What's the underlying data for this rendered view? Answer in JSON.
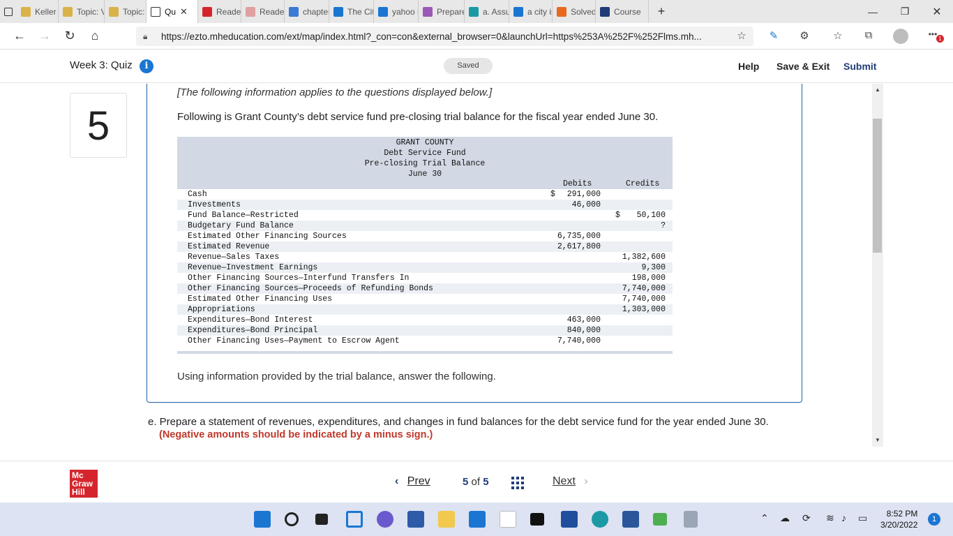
{
  "browser": {
    "tabs": [
      {
        "label": "Keller G",
        "icon": "shield-icon",
        "color": "#d9b24a"
      },
      {
        "label": "Topic: V",
        "icon": "shield-icon",
        "color": "#d9b24a"
      },
      {
        "label": "Topic: W",
        "icon": "shield-icon",
        "color": "#d9b24a"
      },
      {
        "label": "Qu",
        "icon": "page-icon",
        "color": "#ffffff",
        "active": true
      },
      {
        "label": "ReaderL",
        "icon": "mcgraw-icon",
        "color": "#d5252c"
      },
      {
        "label": "ReaderL",
        "icon": "mcgraw-icon",
        "color": "#e0a0a0"
      },
      {
        "label": "chapter",
        "icon": "search-icon",
        "color": "#3a7bd5"
      },
      {
        "label": "The City",
        "icon": "bing-icon",
        "color": "#1b76d2"
      },
      {
        "label": "yahoo n",
        "icon": "bing-icon",
        "color": "#1b76d2"
      },
      {
        "label": "Prepare",
        "icon": "v-icon",
        "color": "#9b59b6"
      },
      {
        "label": "a. Assur",
        "icon": "question-icon",
        "color": "#1b9aa6"
      },
      {
        "label": "a city is",
        "icon": "bing-icon",
        "color": "#1b76d2"
      },
      {
        "label": "Solved",
        "icon": "chegg-icon",
        "color": "#e86a1c"
      },
      {
        "label": "Course",
        "icon": "star-icon",
        "color": "#1f3c77"
      }
    ],
    "url": "https://ezto.mheducation.com/ext/map/index.html?_con=con&external_browser=0&launchUrl=https%253A%252F%252Flms.mh...",
    "profile_badge": "1"
  },
  "quiz": {
    "title": "Week 3: Quiz",
    "saved_label": "Saved",
    "help_label": "Help",
    "save_exit_label": "Save & Exit",
    "submit_label": "Submit",
    "question_number": "5",
    "intro": "[The following information applies to the questions displayed below.]",
    "paragraph": "Following is Grant County’s debt service fund pre-closing trial balance for the fiscal year ended June 30.",
    "table": {
      "title_lines": [
        "GRANT COUNTY",
        "Debt Service Fund",
        "Pre-closing Trial Balance",
        "June 30"
      ],
      "debits_header": "Debits",
      "credits_header": "Credits",
      "rows": [
        {
          "label": "Cash",
          "debit_prefix": "$",
          "debit": "291,000",
          "credit_prefix": "",
          "credit": ""
        },
        {
          "label": "Investments",
          "debit_prefix": "",
          "debit": "46,000",
          "credit_prefix": "",
          "credit": ""
        },
        {
          "label": "Fund Balance—Restricted",
          "debit_prefix": "",
          "debit": "",
          "credit_prefix": "$",
          "credit": "50,100"
        },
        {
          "label": "Budgetary Fund Balance",
          "debit_prefix": "",
          "debit": "",
          "credit_prefix": "",
          "credit": "?"
        },
        {
          "label": "Estimated Other Financing Sources",
          "debit_prefix": "",
          "debit": "6,735,000",
          "credit_prefix": "",
          "credit": ""
        },
        {
          "label": "Estimated Revenue",
          "debit_prefix": "",
          "debit": "2,617,800",
          "credit_prefix": "",
          "credit": ""
        },
        {
          "label": "Revenue—Sales Taxes",
          "debit_prefix": "",
          "debit": "",
          "credit_prefix": "",
          "credit": "1,382,600"
        },
        {
          "label": "Revenue—Investment Earnings",
          "debit_prefix": "",
          "debit": "",
          "credit_prefix": "",
          "credit": "9,300"
        },
        {
          "label": "Other Financing Sources—Interfund Transfers In",
          "debit_prefix": "",
          "debit": "",
          "credit_prefix": "",
          "credit": "198,000"
        },
        {
          "label": "Other Financing Sources—Proceeds of Refunding Bonds",
          "debit_prefix": "",
          "debit": "",
          "credit_prefix": "",
          "credit": "7,740,000"
        },
        {
          "label": "Estimated Other Financing Uses",
          "debit_prefix": "",
          "debit": "",
          "credit_prefix": "",
          "credit": "7,740,000"
        },
        {
          "label": "Appropriations",
          "debit_prefix": "",
          "debit": "",
          "credit_prefix": "",
          "credit": "1,303,000"
        },
        {
          "label": "Expenditures—Bond Interest",
          "debit_prefix": "",
          "debit": "463,000",
          "credit_prefix": "",
          "credit": ""
        },
        {
          "label": "Expenditures—Bond Principal",
          "debit_prefix": "",
          "debit": "840,000",
          "credit_prefix": "",
          "credit": ""
        },
        {
          "label": "Other Financing Uses—Payment to Escrow Agent",
          "debit_prefix": "",
          "debit": "7,740,000",
          "credit_prefix": "",
          "credit": ""
        }
      ]
    },
    "using_text": "Using information provided by the trial balance, answer the following.",
    "part_e": "e. Prepare a statement of revenues, expenditures, and changes in fund balances for the debt service fund for the year ended June 30.",
    "part_e_note": "(Negative amounts should be indicated by a minus sign.)"
  },
  "footer": {
    "logo_lines": [
      "Mc",
      "Graw",
      "Hill"
    ],
    "prev_label": "Prev",
    "page_current": "5",
    "page_of": "of",
    "page_total": "5",
    "next_label": "Next"
  },
  "taskbar": {
    "time": "8:52 PM",
    "date": "3/20/2022",
    "notifications": "1"
  }
}
